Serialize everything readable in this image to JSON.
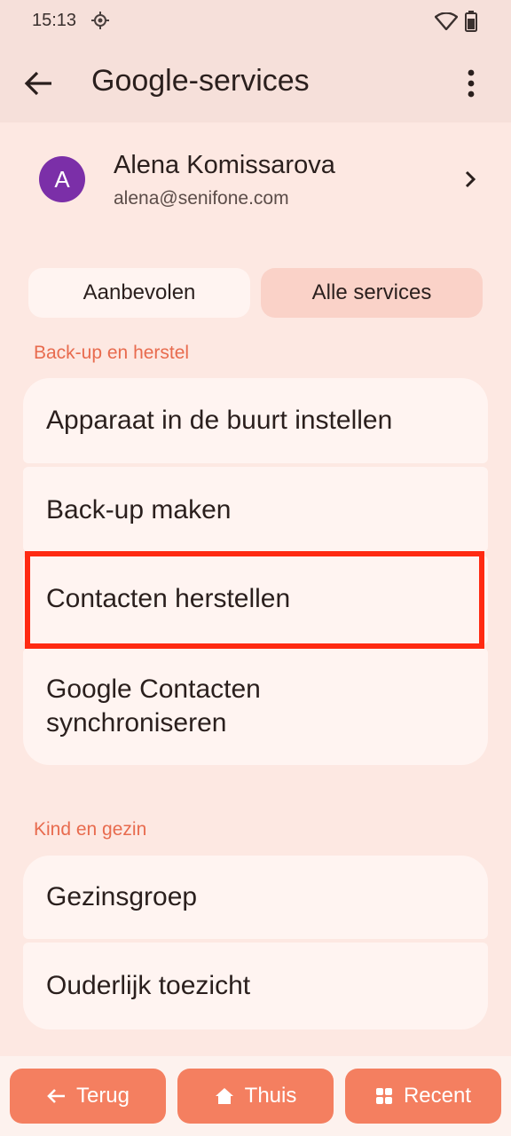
{
  "status": {
    "time": "15:13"
  },
  "app_bar": {
    "title": "Google-services"
  },
  "account": {
    "initial": "A",
    "name": "Alena Komissarova",
    "email": "alena@senifone.com"
  },
  "tabs": [
    {
      "label": "Aanbevolen"
    },
    {
      "label": "Alle services"
    }
  ],
  "sections": [
    {
      "label": "Back-up en herstel",
      "items": [
        {
          "label": "Apparaat in de buurt instellen"
        },
        {
          "label": "Back-up maken"
        },
        {
          "label": "Contacten herstellen"
        },
        {
          "label_line1": "Google Contacten",
          "label_line2": "synchroniseren"
        }
      ]
    },
    {
      "label": "Kind en gezin",
      "items": [
        {
          "label": "Gezinsgroep"
        },
        {
          "label": "Ouderlijk toezicht"
        }
      ]
    }
  ],
  "nav": {
    "back": "Terug",
    "home": "Thuis",
    "recent": "Recent"
  },
  "colors": {
    "accent": "#e86b4e",
    "highlight": "#ff2a12",
    "avatar": "#7b2fa8",
    "nav_button": "#f47f60"
  }
}
